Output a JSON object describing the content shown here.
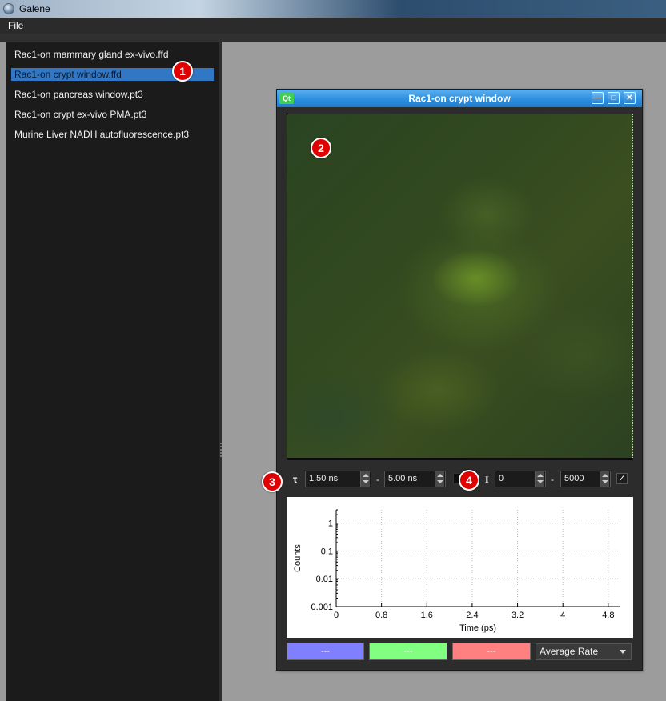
{
  "app": {
    "title": "Galene"
  },
  "menu": {
    "file_label": "File"
  },
  "files": [
    {
      "label": "Rac1-on mammary gland ex-vivo.ffd"
    },
    {
      "label": "Rac1-on crypt window.ffd"
    },
    {
      "label": "Rac1-on pancreas window.pt3"
    },
    {
      "label": "Rac1-on crypt ex-vivo PMA.pt3"
    },
    {
      "label": "Murine Liver NADH autofluorescence.pt3"
    }
  ],
  "selected_file_index": 1,
  "subwindow": {
    "title": "Rac1-on crypt window",
    "app_icon_label": "Qt",
    "minimize_glyph": "—",
    "maximize_glyph": "□",
    "close_glyph": "✕"
  },
  "controls": {
    "tau_symbol": "τ",
    "tau_min": "1.50 ns",
    "tau_max": "5.00 ns",
    "range_separator": "-",
    "intensity_symbol": "I",
    "intensity_min": "0",
    "intensity_max": "5000",
    "auto_checked_glyph": "✓"
  },
  "chart_data": {
    "type": "line",
    "xlabel": "Time (ps)",
    "ylabel": "Counts",
    "x_ticks": [
      "0",
      "0.8",
      "1.6",
      "2.4",
      "3.2",
      "4",
      "4.8"
    ],
    "y_ticks": [
      "1",
      "0.1",
      "0.01",
      "0.001"
    ],
    "y_scale": "log",
    "xlim": [
      0,
      5
    ],
    "ylim": [
      0.001,
      3
    ],
    "grid": true,
    "series": []
  },
  "bottom": {
    "blue_button": "---",
    "green_button": "---",
    "red_button": "---",
    "blue_color": "#8080ff",
    "green_color": "#80ff80",
    "red_color": "#ff8080",
    "mode_select": "Average Rate"
  },
  "annotations": [
    "1",
    "2",
    "3",
    "4"
  ],
  "colors": {
    "selection": "#3277c4",
    "titlebar_active": "#2c8fe0",
    "marker": "#e10000"
  }
}
